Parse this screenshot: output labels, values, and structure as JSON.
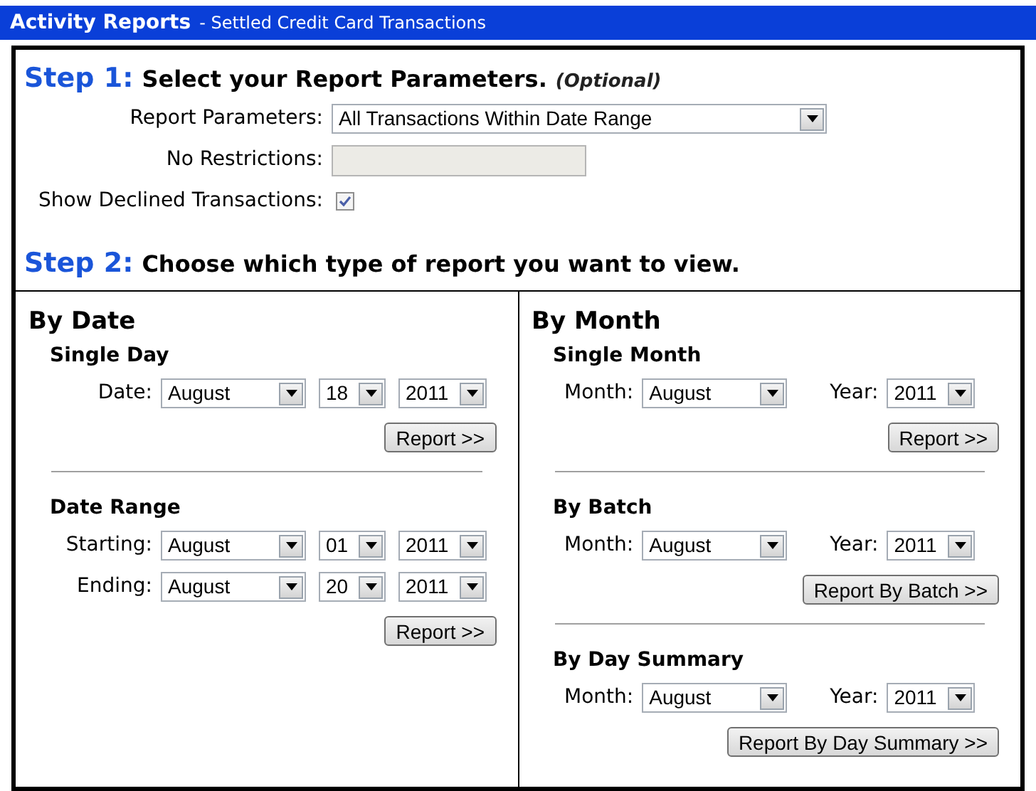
{
  "header": {
    "title": "Activity Reports",
    "subtitle": "- Settled Credit Card Transactions"
  },
  "step1": {
    "step": "Step 1:",
    "heading": "Select your Report Parameters.",
    "note": "(Optional)",
    "fields": [
      {
        "kind": "select",
        "label": "Report Parameters:",
        "value": "All Transactions Within Date Range"
      },
      {
        "kind": "text",
        "label": "No Restrictions:",
        "disabled": true
      },
      {
        "kind": "checkbox",
        "label": "Show Declined Transactions:",
        "checked": true
      }
    ]
  },
  "step2": {
    "step": "Step 2:",
    "heading": "Choose which type of report you want to view."
  },
  "columns": [
    {
      "title": "By Date",
      "sections": [
        {
          "title": "Single Day",
          "rows": [
            {
              "items": [
                {
                  "kind": "label",
                  "text": "Date:"
                },
                {
                  "kind": "month",
                  "value": "August"
                },
                {
                  "kind": "day",
                  "value": "18"
                },
                {
                  "kind": "year",
                  "value": "2011"
                }
              ]
            }
          ],
          "button": "Report >>"
        },
        {
          "title": "Date Range",
          "rows": [
            {
              "items": [
                {
                  "kind": "label",
                  "text": "Starting:"
                },
                {
                  "kind": "month",
                  "value": "August"
                },
                {
                  "kind": "day",
                  "value": "01"
                },
                {
                  "kind": "year",
                  "value": "2011"
                }
              ]
            },
            {
              "items": [
                {
                  "kind": "label",
                  "text": "Ending:"
                },
                {
                  "kind": "month",
                  "value": "August"
                },
                {
                  "kind": "day",
                  "value": "20"
                },
                {
                  "kind": "year",
                  "value": "2011"
                }
              ]
            }
          ],
          "button": "Report >>"
        }
      ]
    },
    {
      "title": "By Month",
      "sections": [
        {
          "title": "Single Month",
          "rows": [
            {
              "items": [
                {
                  "kind": "label",
                  "text": "Month:"
                },
                {
                  "kind": "month",
                  "value": "August"
                },
                {
                  "kind": "label",
                  "text": "Year:"
                },
                {
                  "kind": "year",
                  "value": "2011"
                }
              ]
            }
          ],
          "button": "Report >>"
        },
        {
          "title": "By Batch",
          "rows": [
            {
              "items": [
                {
                  "kind": "label",
                  "text": "Month:"
                },
                {
                  "kind": "month",
                  "value": "August"
                },
                {
                  "kind": "label",
                  "text": "Year:"
                },
                {
                  "kind": "year",
                  "value": "2011"
                }
              ]
            }
          ],
          "button": "Report By Batch >>"
        },
        {
          "title": "By Day Summary",
          "rows": [
            {
              "items": [
                {
                  "kind": "label",
                  "text": "Month:"
                },
                {
                  "kind": "month",
                  "value": "August"
                },
                {
                  "kind": "label",
                  "text": "Year:"
                },
                {
                  "kind": "year",
                  "value": "2011"
                }
              ]
            }
          ],
          "button": "Report By Day Summary >>"
        }
      ]
    }
  ]
}
